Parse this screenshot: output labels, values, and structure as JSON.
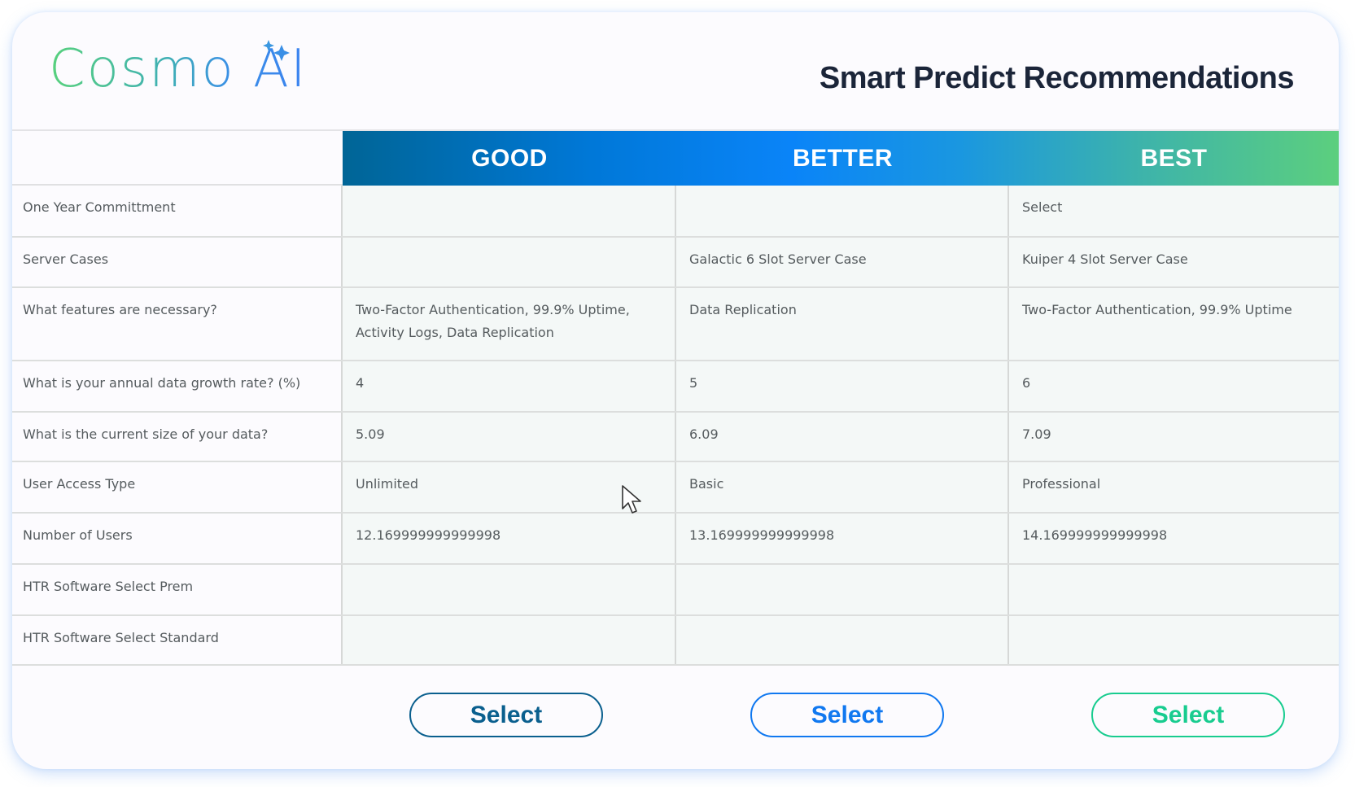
{
  "brand": {
    "name": "Cosmo",
    "suffix": "AI",
    "logo_icon": "sparkle-icon",
    "gradient_colors": [
      "#58d17c",
      "#3fb0b3",
      "#3b82f0"
    ]
  },
  "header": {
    "title": "Smart Predict Recommendations"
  },
  "table": {
    "columns": [
      {
        "label": "GOOD",
        "accent": "#006596"
      },
      {
        "label": "BETTER",
        "accent": "#0a84f8"
      },
      {
        "label": "BEST",
        "accent": "#5ccf7e"
      }
    ],
    "rows": [
      {
        "label": "One Year Committment",
        "values": [
          "",
          "",
          "Select"
        ]
      },
      {
        "label": "Server Cases",
        "values": [
          "",
          "Galactic 6 Slot Server Case",
          "Kuiper 4 Slot Server Case"
        ]
      },
      {
        "label": "What features are necessary?",
        "values": [
          "Two-Factor Authentication, 99.9% Uptime, Activity Logs, Data Replication",
          "Data Replication",
          "Two-Factor Authentication, 99.9% Uptime"
        ]
      },
      {
        "label": "What is your annual data growth rate? (%)",
        "values": [
          "4",
          "5",
          "6"
        ]
      },
      {
        "label": "What is the current size of your data?",
        "values": [
          "5.09",
          "6.09",
          "7.09"
        ]
      },
      {
        "label": "User Access Type",
        "values": [
          "Unlimited",
          "Basic",
          "Professional"
        ]
      },
      {
        "label": "Number of Users",
        "values": [
          "12.169999999999998",
          "13.169999999999998",
          "14.169999999999998"
        ]
      },
      {
        "label": "HTR Software Select Prem",
        "values": [
          "",
          "",
          ""
        ]
      },
      {
        "label": "HTR Software Select Standard",
        "values": [
          "",
          "",
          ""
        ]
      }
    ]
  },
  "actions": {
    "good_label": "Select",
    "better_label": "Select",
    "best_label": "Select",
    "colors": {
      "good": "#0a5f8e",
      "better": "#1078f0",
      "best": "#18cc8f"
    }
  },
  "pointer": {
    "icon": "mouse-cursor-icon"
  }
}
